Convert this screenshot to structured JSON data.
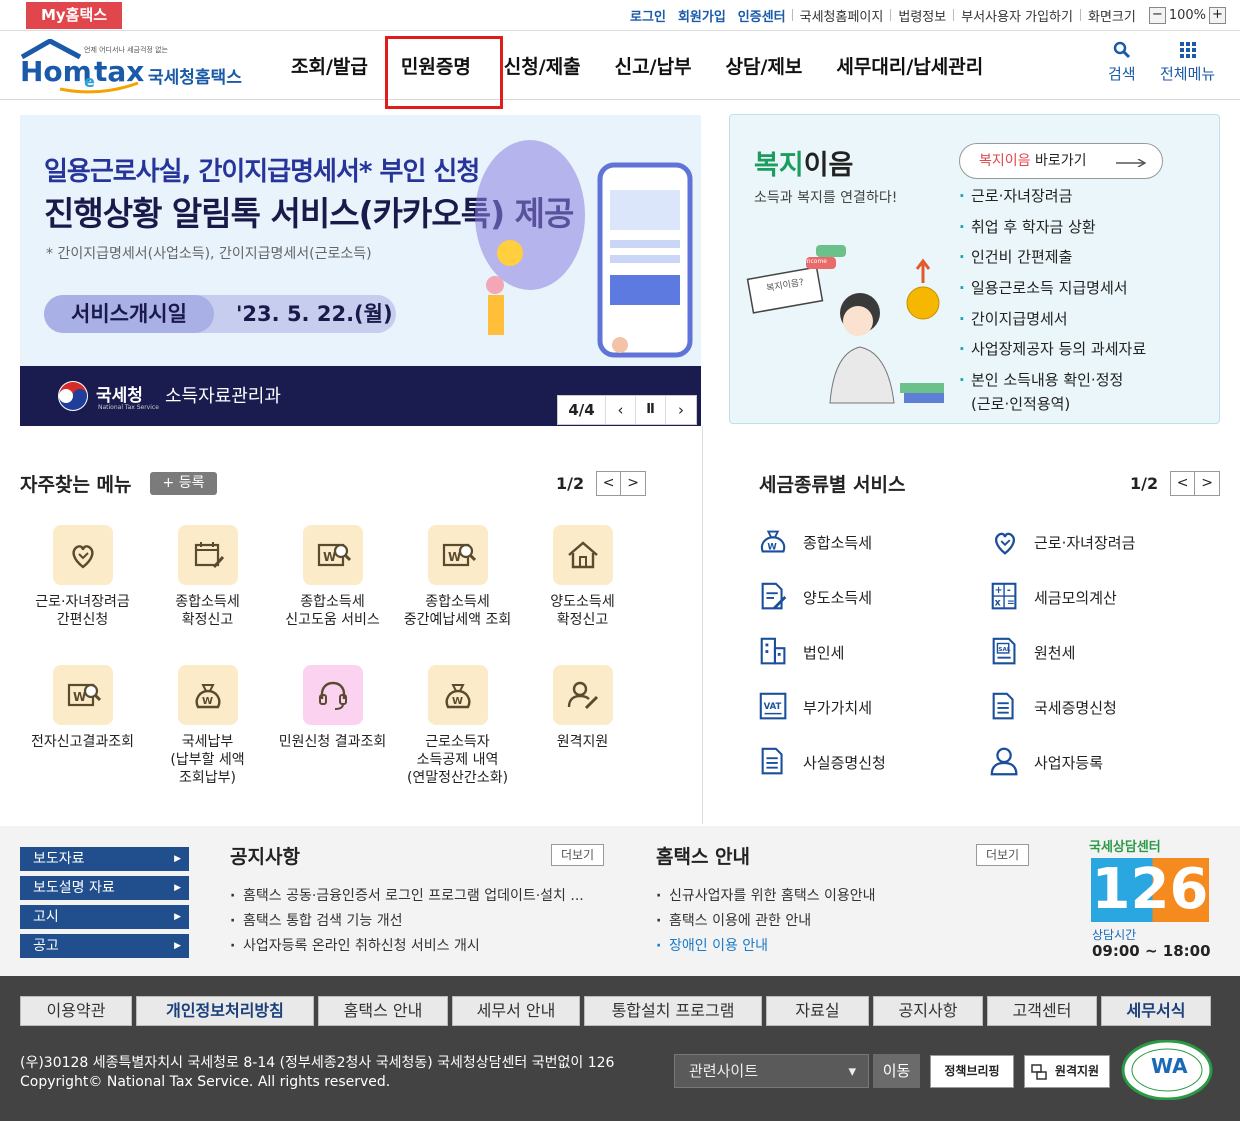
{
  "topbar": {
    "my_hometax": "My홈택스",
    "links_blue": [
      "로그인",
      "회원가입",
      "인증센터"
    ],
    "links": [
      "국세청홈페이지",
      "법령정보",
      "부서사용자 가입하기",
      "화면크기"
    ],
    "zoom_minus": "−",
    "zoom_value": "100%",
    "zoom_plus": "+"
  },
  "header": {
    "logo_main": "Hometax",
    "logo_sub": "국세청홈택스",
    "logo_tag": "언제 어디서나 세금걱정 없는",
    "nav": [
      "조회/발급",
      "민원증명",
      "신청/제출",
      "신고/납부",
      "상담/제보",
      "세무대리/납세관리"
    ],
    "highlighted_nav": "민원증명",
    "search_label": "검색",
    "allmenu_label": "전체메뉴",
    "accent": "#1a5aa8",
    "highlight_color": "#e01c1c"
  },
  "banner": {
    "line1": "일용근로사실, 간이지급명세서* 부인 신청",
    "line2": "진행상황 알림톡 서비스(카카오톡) 제공",
    "note": "* 간이지급명세서(사업소득), 간이지급명세서(근로소득)",
    "pill_left": "서비스개시일",
    "pill_right": "'23. 5. 22.(월)",
    "org": "국세청",
    "org_en": "National Tax Service",
    "dept": "소득자료관리과",
    "page": "4/4",
    "prev": "‹",
    "pause": "Ⅱ",
    "next": "›"
  },
  "welfare": {
    "title_green": "복지",
    "title_rest": "이음",
    "subtitle": "소득과 복지를 연결하다!",
    "go_red": "복지이음",
    "go_rest": " 바로가기",
    "bubble": "복지이음?",
    "income": "income",
    "items": [
      "근로·자녀장려금",
      "취업 후 학자금 상환",
      "인건비 간편제출",
      "일용근로소득 지급명세서",
      "간이지급명세서",
      "사업장제공자 등의 과세자료",
      "본인 소득내용 확인·정정",
      "(근로·인적용역)"
    ]
  },
  "frequent": {
    "title": "자주찾는 메뉴",
    "register": "+ 등록",
    "page": "1/2",
    "prev": "<",
    "next": ">",
    "items": [
      {
        "label": "근로·자녀장려금\n간편신청",
        "icon": "heart-hand-icon"
      },
      {
        "label": "종합소득세\n확정신고",
        "icon": "calendar-edit-icon"
      },
      {
        "label": "종합소득세\n신고도움 서비스",
        "icon": "won-search-icon"
      },
      {
        "label": "종합소득세\n중간예납세액 조회",
        "icon": "won-search-icon"
      },
      {
        "label": "양도소득세\n확정신고",
        "icon": "house-icon"
      },
      {
        "label": "전자신고결과조회",
        "icon": "won-search-icon"
      },
      {
        "label": "국세납부\n(납부할 세액\n조회납부)",
        "icon": "money-bag-icon"
      },
      {
        "label": "민원신청 결과조회",
        "icon": "headset-icon"
      },
      {
        "label": "근로소득자\n소득공제 내역\n(연말정산간소화)",
        "icon": "money-bag-icon"
      },
      {
        "label": "원격지원",
        "icon": "person-edit-icon"
      }
    ]
  },
  "tax_service": {
    "title": "세금종류별 서비스",
    "page": "1/2",
    "prev": "<",
    "next": ">",
    "items": [
      {
        "label": "종합소득세",
        "icon": "won-bag-icon"
      },
      {
        "label": "근로·자녀장려금",
        "icon": "heart-hand-icon"
      },
      {
        "label": "양도소득세",
        "icon": "document-edit-icon"
      },
      {
        "label": "세금모의계산",
        "icon": "calculator-icon"
      },
      {
        "label": "법인세",
        "icon": "building-icon"
      },
      {
        "label": "원천세",
        "icon": "salary-doc-icon"
      },
      {
        "label": "부가가치세",
        "icon": "vat-icon"
      },
      {
        "label": "국세증명신청",
        "icon": "document-icon"
      },
      {
        "label": "사실증명신청",
        "icon": "document-icon"
      },
      {
        "label": "사업자등록",
        "icon": "person-icon"
      }
    ]
  },
  "notice_band": {
    "press": [
      "보도자료",
      "보도설명 자료",
      "고시",
      "공고"
    ],
    "notice_title": "공지사항",
    "notice_more": "더보기",
    "notices": [
      "홈택스 공동·금융인증서 로그인 프로그램 업데이트·설치 ...",
      "홈택스 통합 검색 기능 개선",
      "사업자등록 온라인 취하신청 서비스 개시"
    ],
    "guide_title": "홈택스 안내",
    "guide_more": "더보기",
    "guides": [
      "신규사업자를 위한 홈택스 이용안내",
      "홈택스 이용에 관한 안내",
      "장애인 이용 안내"
    ],
    "center_title": "국세상담센터",
    "center_number": "126",
    "center_hours_label": "상담시간",
    "center_hours": "09:00 ~ 18:00"
  },
  "footer": {
    "nav": [
      "이용약관",
      "개인정보처리방침",
      "홈택스 안내",
      "세무서 안내",
      "통합설치 프로그램",
      "자료실",
      "공지사항",
      "고객센터",
      "세무서식"
    ],
    "address": "(우)30128 세종특별자치시 국세청로 8-14 (정부세종2청사 국세청동) 국세청상담센터 국번없이 126",
    "copyright": "Copyright© National Tax Service. All rights reserved.",
    "related_sites": "관련사이트",
    "go": "이동",
    "badge1": "정책브리핑",
    "badge2": "원격지원",
    "wa_mark": "WA"
  }
}
